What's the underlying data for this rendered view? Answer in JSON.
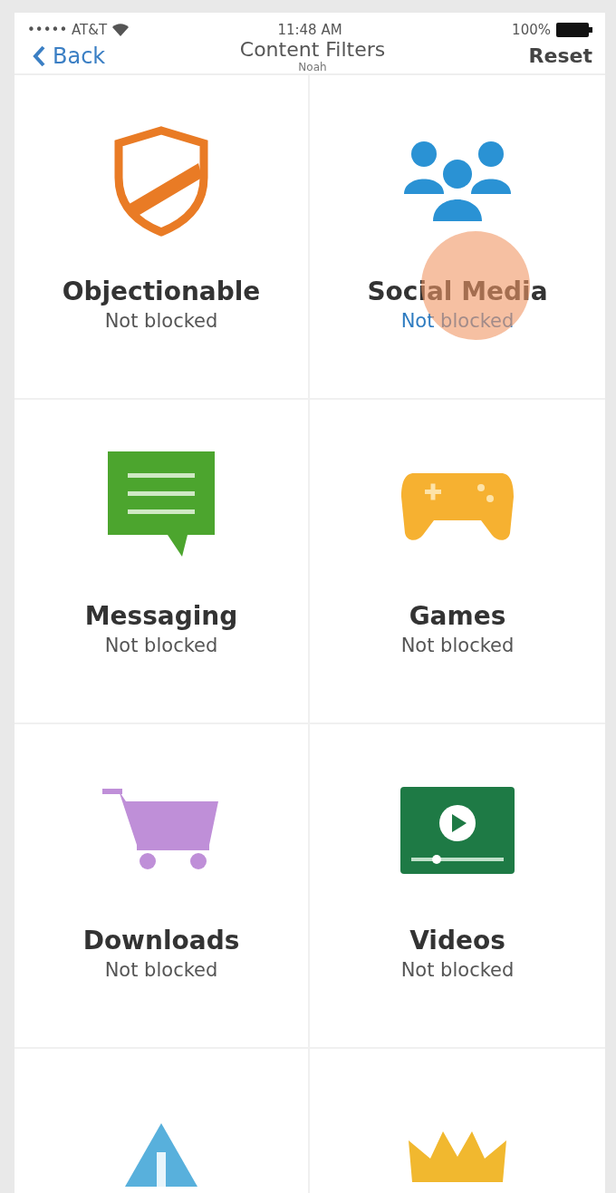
{
  "status_bar": {
    "carrier": "••••• AT&T",
    "time": "11:48 AM",
    "battery": "100%"
  },
  "nav": {
    "back": "Back",
    "title": "Content Filters",
    "subtitle": "Noah",
    "action": "Reset"
  },
  "tiles": [
    {
      "kind": "shield",
      "title": "Objectionable",
      "status": "Not blocked",
      "selected": false
    },
    {
      "kind": "people",
      "title": "Social Media",
      "status": "Not blocked",
      "selected": true
    },
    {
      "kind": "message",
      "title": "Messaging",
      "status": "Not blocked",
      "selected": false
    },
    {
      "kind": "gamepad",
      "title": "Games",
      "status": "Not blocked",
      "selected": false
    },
    {
      "kind": "cart",
      "title": "Downloads",
      "status": "Not blocked",
      "selected": false
    },
    {
      "kind": "video",
      "title": "Videos",
      "status": "Not blocked",
      "selected": false
    },
    {
      "kind": "alert"
    },
    {
      "kind": "crown"
    }
  ]
}
